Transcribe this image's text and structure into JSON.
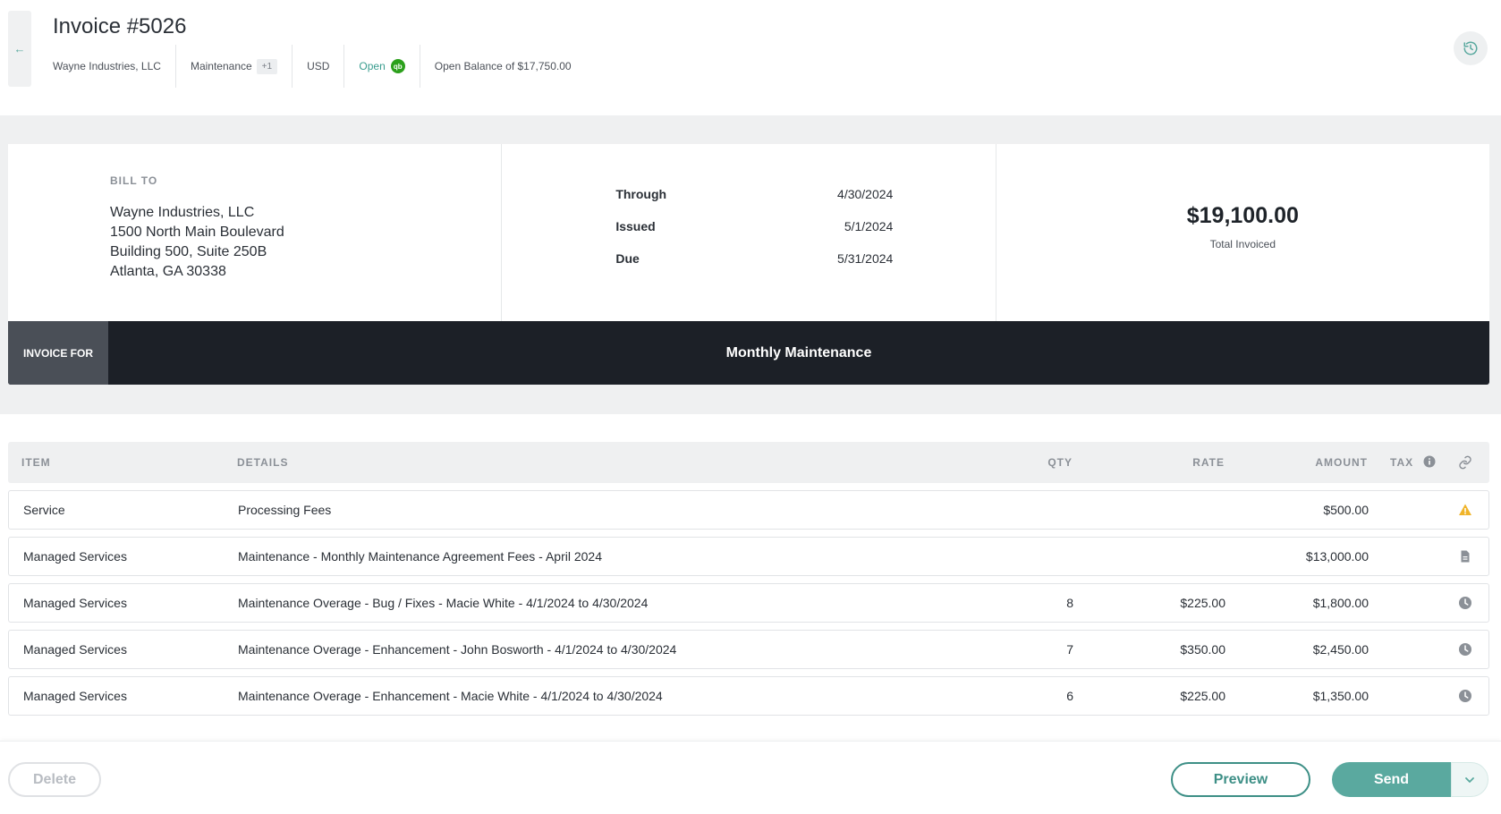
{
  "header": {
    "title": "Invoice #5026",
    "client": "Wayne Industries, LLC",
    "category": "Maintenance",
    "category_extra": "+1",
    "currency": "USD",
    "status": "Open",
    "qb_badge": "qb",
    "open_balance": "Open Balance of $17,750.00"
  },
  "bill_to": {
    "label": "BILL TO",
    "lines": [
      "Wayne Industries, LLC",
      "1500 North Main Boulevard",
      "Building 500, Suite 250B",
      "Atlanta, GA 30338"
    ]
  },
  "dates": {
    "through_label": "Through",
    "through": "4/30/2024",
    "issued_label": "Issued",
    "issued": "5/1/2024",
    "due_label": "Due",
    "due": "5/31/2024"
  },
  "total": {
    "value": "$19,100.00",
    "label": "Total Invoiced"
  },
  "invoice_for": {
    "label": "INVOICE FOR",
    "value": "Monthly Maintenance"
  },
  "table": {
    "headers": {
      "item": "ITEM",
      "details": "DETAILS",
      "qty": "QTY",
      "rate": "RATE",
      "amount": "AMOUNT",
      "tax": "TAX"
    },
    "rows": [
      {
        "item": "Service",
        "details": "Processing Fees",
        "qty": "",
        "rate": "",
        "amount": "$500.00",
        "icon": "warning-icon"
      },
      {
        "item": "Managed Services",
        "details": "Maintenance - Monthly Maintenance Agreement Fees - April 2024",
        "qty": "",
        "rate": "",
        "amount": "$13,000.00",
        "icon": "document-icon"
      },
      {
        "item": "Managed Services",
        "details": "Maintenance Overage - Bug / Fixes - Macie White  - 4/1/2024 to 4/30/2024",
        "qty": "8",
        "rate": "$225.00",
        "amount": "$1,800.00",
        "icon": "clock-icon"
      },
      {
        "item": "Managed Services",
        "details": "Maintenance Overage - Enhancement - John Bosworth - 4/1/2024 to 4/30/2024",
        "qty": "7",
        "rate": "$350.00",
        "amount": "$2,450.00",
        "icon": "clock-icon"
      },
      {
        "item": "Managed Services",
        "details": "Maintenance Overage - Enhancement - Macie White  - 4/1/2024 to 4/30/2024",
        "qty": "6",
        "rate": "$225.00",
        "amount": "$1,350.00",
        "icon": "clock-icon"
      }
    ]
  },
  "footer": {
    "delete_label": "Delete",
    "preview_label": "Preview",
    "send_label": "Send"
  },
  "colors": {
    "accent": "#5aa99f",
    "dark_band": "#1c2027",
    "warning": "#f0b429",
    "qb_green": "#2ca01c"
  }
}
